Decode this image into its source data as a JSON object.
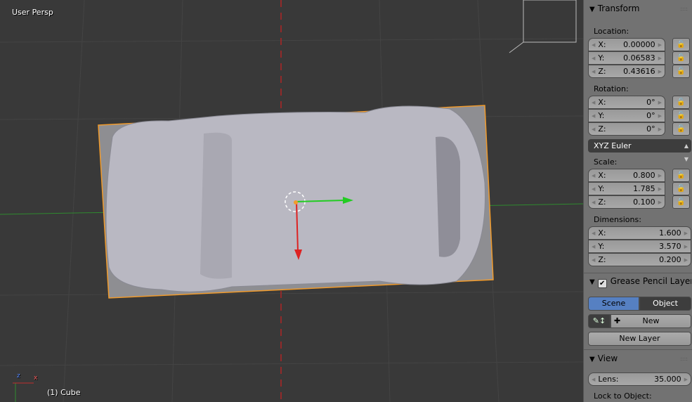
{
  "viewport": {
    "view_label": "User Persp",
    "object_label": "(1) Cube",
    "axis_x": "x",
    "axis_z": "z"
  },
  "transform": {
    "title": "Transform",
    "location_label": "Location:",
    "location": [
      {
        "axis": "X:",
        "value": "0.00000"
      },
      {
        "axis": "Y:",
        "value": "0.06583"
      },
      {
        "axis": "Z:",
        "value": "0.43616"
      }
    ],
    "rotation_label": "Rotation:",
    "rotation": [
      {
        "axis": "X:",
        "value": "0°"
      },
      {
        "axis": "Y:",
        "value": "0°"
      },
      {
        "axis": "Z:",
        "value": "0°"
      }
    ],
    "rotation_mode": "XYZ Euler",
    "scale_label": "Scale:",
    "scale": [
      {
        "axis": "X:",
        "value": "0.800"
      },
      {
        "axis": "Y:",
        "value": "1.785"
      },
      {
        "axis": "Z:",
        "value": "0.100"
      }
    ],
    "dimensions_label": "Dimensions:",
    "dimensions": [
      {
        "axis": "X:",
        "value": "1.600"
      },
      {
        "axis": "Y:",
        "value": "3.570"
      },
      {
        "axis": "Z:",
        "value": "0.200"
      }
    ]
  },
  "grease_pencil": {
    "title": "Grease Pencil Layers",
    "checked": true,
    "tab_scene": "Scene",
    "tab_object": "Object",
    "active_tab": "Scene",
    "new_label": "New",
    "new_layer_label": "New Layer"
  },
  "view": {
    "title": "View",
    "lens_label": "Lens:",
    "lens_value": "35.000",
    "lock_label": "Lock to Object:"
  },
  "colors": {
    "accent": "#5680c2",
    "selection": "#f19b2c",
    "axis_x": "#c03030",
    "axis_y": "#30b030"
  }
}
